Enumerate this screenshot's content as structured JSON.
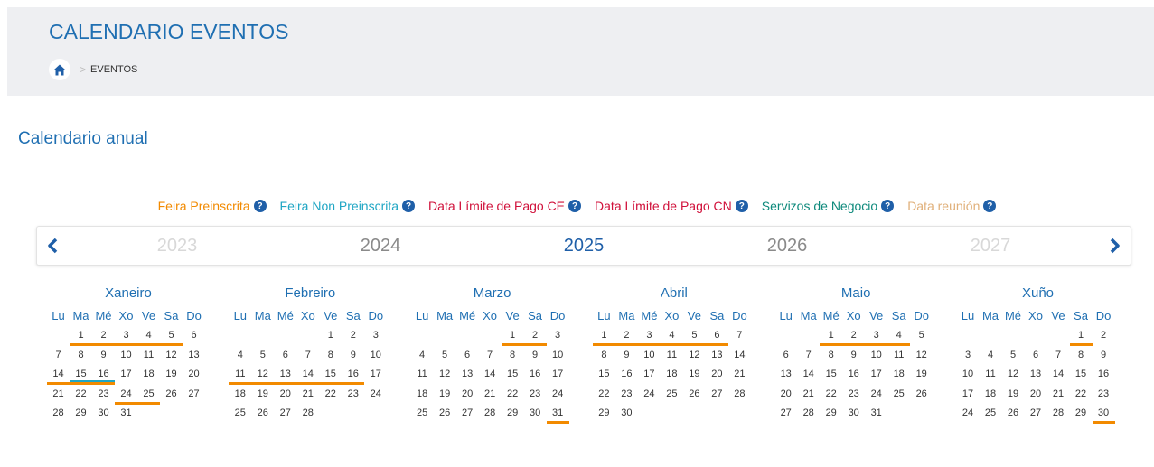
{
  "header": {
    "title": "CALENDARIO EVENTOS",
    "breadcrumb": [
      {
        "label": "EVENTOS"
      }
    ]
  },
  "section_title": "Calendario anual",
  "legend": [
    {
      "label": "Feira Preinscrita",
      "color": "#f28a00"
    },
    {
      "label": "Feira Non Preinscrita",
      "color": "#1fa6c4"
    },
    {
      "label": "Data Límite de Pago CE",
      "color": "#d0103a"
    },
    {
      "label": "Data Límite de Pago CN",
      "color": "#d0103a"
    },
    {
      "label": "Servizos de Negocio",
      "color": "#0e8a7c"
    },
    {
      "label": "Data reunión",
      "color": "#e0b07a"
    }
  ],
  "years": [
    {
      "label": "2023",
      "state": "far"
    },
    {
      "label": "2024",
      "state": "near"
    },
    {
      "label": "2025",
      "state": "active"
    },
    {
      "label": "2026",
      "state": "near"
    },
    {
      "label": "2027",
      "state": "far"
    }
  ],
  "day_names": [
    "Lu",
    "Ma",
    "Mé",
    "Xo",
    "Ve",
    "Sa",
    "Do"
  ],
  "months": [
    {
      "name": "Xaneiro",
      "start": 2,
      "days": 31,
      "marks": [
        [
          1,
          5
        ],
        [
          6,
          10
        ],
        [
          14,
          16
        ],
        [
          24,
          25
        ]
      ],
      "blue_marks": [
        [
          15,
          16
        ]
      ]
    },
    {
      "name": "Febreiro",
      "start": 5,
      "days": 28,
      "marks": [
        [
          11,
          16
        ],
        [
          17,
          23
        ],
        [
          24,
          28
        ]
      ],
      "blue_marks": []
    },
    {
      "name": "Marzo",
      "start": 5,
      "days": 31,
      "marks": [
        [
          1,
          2
        ],
        [
          3,
          9
        ],
        [
          10,
          16
        ],
        [
          17,
          23
        ],
        [
          24,
          30
        ],
        [
          31,
          31
        ]
      ],
      "blue_marks": []
    },
    {
      "name": "Abril",
      "start": 1,
      "days": 30,
      "marks": [
        [
          1,
          6
        ],
        [
          7,
          13
        ],
        [
          14,
          20
        ],
        [
          21,
          27
        ],
        [
          28,
          30
        ]
      ],
      "blue_marks": []
    },
    {
      "name": "Maio",
      "start": 3,
      "days": 31,
      "marks": [
        [
          1,
          4
        ],
        [
          5,
          11
        ],
        [
          12,
          18
        ],
        [
          19,
          25
        ],
        [
          26,
          31
        ]
      ],
      "blue_marks": [
        [
          5,
          8
        ]
      ]
    },
    {
      "name": "Xuño",
      "start": 6,
      "days": 30,
      "marks": [
        [
          1,
          1
        ],
        [
          2,
          8
        ],
        [
          9,
          15
        ],
        [
          16,
          22
        ],
        [
          23,
          29
        ],
        [
          30,
          30
        ]
      ],
      "blue_marks": []
    }
  ]
}
